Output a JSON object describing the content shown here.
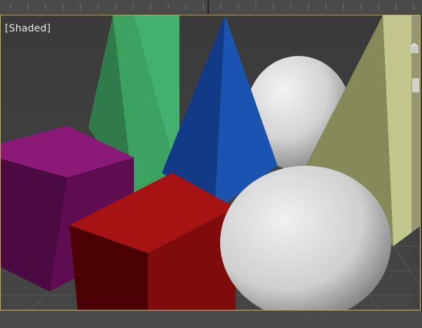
{
  "viewport": {
    "label": "[Shaded]"
  },
  "colors": {
    "frame": "#c7b250",
    "background": "#3c3c3c",
    "grid": "#5a5a5a",
    "purple_box": "#8a1a78",
    "red_box": "#a01414",
    "green_pyramid": "#3b9b5e",
    "blue_pyramid": "#1a4ea5",
    "olive_pyramid": "#b9be86",
    "sphere": "#d9d9d9"
  },
  "icons": {
    "viewcube": "viewcube-icon"
  }
}
